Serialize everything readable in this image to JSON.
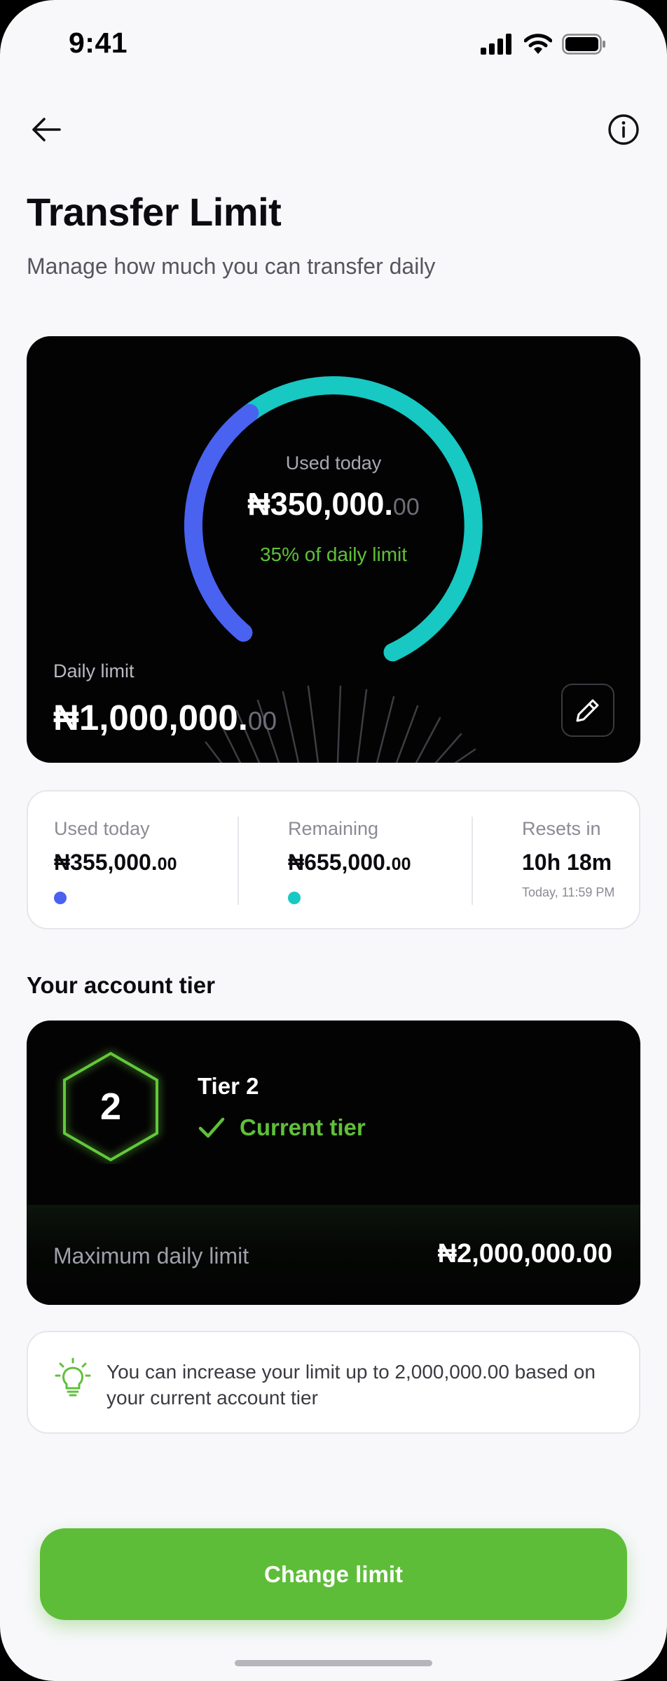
{
  "status_bar": {
    "time": "9:41"
  },
  "header": {
    "back_icon": "arrow-left-icon",
    "info_icon": "info-circle-icon",
    "title": "Transfer Limit",
    "subtitle": "Manage how much you can transfer daily"
  },
  "usage_card": {
    "used_label": "Used today",
    "used_amount_main": "₦350,000.",
    "used_amount_decimal": "00",
    "percent_text": "35% of daily limit",
    "progress_percent": 35,
    "daily_limit_label": "Daily limit",
    "daily_limit_main": "₦1,000,000.",
    "daily_limit_decimal": "00",
    "edit_icon": "pencil-icon"
  },
  "stats": {
    "used": {
      "label": "Used today",
      "main": "₦355,000.",
      "decimal": "00",
      "dot_color": "#4a62f0"
    },
    "remaining": {
      "label": "Remaining",
      "main": "₦655,000.",
      "decimal": "00",
      "dot_color": "#17c8c3"
    },
    "resets": {
      "label": "Resets in",
      "value": "10h 18m",
      "sub": "Today, 11:59 PM"
    }
  },
  "tier_section": {
    "title": "Your account tier",
    "tier_number": "2",
    "tier_name": "Tier 2",
    "tier_status": "Current tier",
    "check_icon": "checkmark-icon",
    "max_label": "Maximum daily limit",
    "max_value": "₦2,000,000.00"
  },
  "info_note": {
    "icon": "lightbulb-icon",
    "text": "You can increase your limit up to 2,000,000.00 based on your current account tier"
  },
  "cta": {
    "label": "Change limit"
  },
  "colors": {
    "accent_green": "#5dbd38",
    "gauge_blue": "#4a62f0",
    "gauge_teal": "#17c8c3"
  }
}
